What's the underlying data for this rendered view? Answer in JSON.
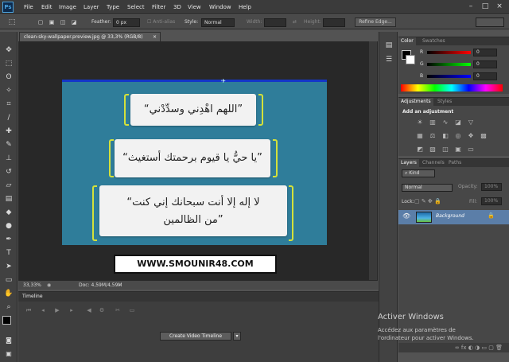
{
  "app": {
    "logo": "Ps"
  },
  "menu": [
    "File",
    "Edit",
    "Image",
    "Layer",
    "Type",
    "Select",
    "Filter",
    "3D",
    "View",
    "Window",
    "Help"
  ],
  "window_controls": {
    "minimize": "–",
    "maximize": "□",
    "close": "×"
  },
  "options": {
    "feather_label": "Feather:",
    "feather_value": "0 px",
    "antialias_label": "Anti-alias",
    "style_label": "Style:",
    "style_value": "Normal",
    "width_label": "Width:",
    "height_label": "Height:",
    "refine_label": "Refine Edge..."
  },
  "document": {
    "tab_title": "clean-sky-wallpaper.preview.jpg @ 33,3% (RGB/8)",
    "close": "×"
  },
  "artwork": {
    "line1": "“اللهم اهْدِني وسدِّدْني”",
    "line2": "“يا حيُّ يا قيوم برحمتك أستغيث”",
    "line3a": "“لا إله إلا أنت سبحانك إني كنت",
    "line3b": "من الظالمين”",
    "watermark": "WWW.SMOUNIR48.COM"
  },
  "status": {
    "zoom": "33,33%",
    "doc": "Doc: 4,59M/4,59M"
  },
  "timeline": {
    "title": "Timeline",
    "create_label": "Create Video Timeline",
    "dropdown": "▾"
  },
  "color_panel": {
    "tab_active": "Color",
    "tab_inactive": "Swatches",
    "r_label": "R",
    "g_label": "G",
    "b_label": "B",
    "r_value": "0",
    "g_value": "0",
    "b_value": "0"
  },
  "adjustments": {
    "tab_active": "Adjustments",
    "tab_inactive": "Styles",
    "heading": "Add an adjustment"
  },
  "layers": {
    "tab_active": "Layers",
    "tab_channels": "Channels",
    "tab_paths": "Paths",
    "kind_label": "Kind",
    "blend_mode": "Normal",
    "opacity_label": "Opacity:",
    "opacity_value": "100%",
    "lock_label": "Lock:",
    "fill_label": "Fill:",
    "fill_value": "100%",
    "layer_name": "Background"
  },
  "activation": {
    "title": "Activer Windows",
    "line1": "Accédez aux paramètres de",
    "line2": "l'ordinateur pour activer Windows."
  },
  "colors": {
    "accent": "#5b7ea8",
    "canvas_teal": "#2f7d9a",
    "bracket": "#d4e13a",
    "blue_line": "#1436c8"
  }
}
